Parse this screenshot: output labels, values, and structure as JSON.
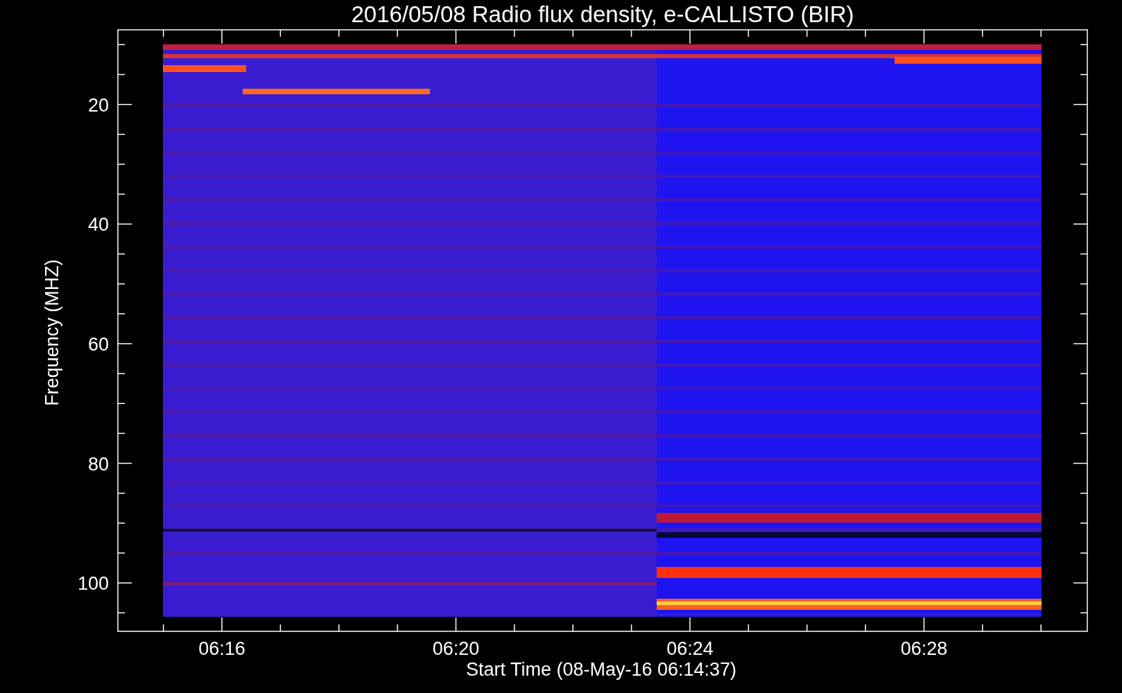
{
  "plot": {
    "title": "2016/05/08  Radio flux density, e-CALLISTO (BIR)",
    "xlabel": "Start Time (08-May-16 06:14:37)",
    "ylabel": "Frequency (MHZ)",
    "xticks": [
      "06:16",
      "06:20",
      "06:24",
      "06:28"
    ],
    "yticks": [
      "20",
      "40",
      "60",
      "80",
      "100"
    ]
  }
}
